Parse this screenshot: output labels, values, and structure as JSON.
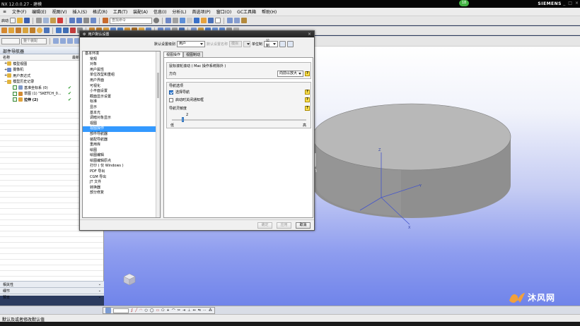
{
  "window": {
    "title": "NX 12.0.0.27 - 建模",
    "brand": "SIEMENS",
    "badge": "18"
  },
  "menubar": {
    "items": [
      "文件(F)",
      "编辑(E)",
      "视图(V)",
      "插入(S)",
      "格式(R)",
      "工具(T)",
      "装配(A)",
      "信息(I)",
      "分析(L)",
      "首选项(P)",
      "窗口(O)",
      "GC工具箱",
      "帮助(H)"
    ]
  },
  "toolbar": {
    "start_label": "启动",
    "search_placeholder": "查找命令",
    "filter_label": "整个装配"
  },
  "part_navigator": {
    "title": "部件导航器",
    "col_name": "名称",
    "col_latest": "最新",
    "rows": [
      {
        "label": "模型视图",
        "indent": 1,
        "type": "folder",
        "check": ""
      },
      {
        "label": "摄像机",
        "indent": 1,
        "type": "folder",
        "check": ""
      },
      {
        "label": "用户表达式",
        "indent": 1,
        "type": "folder",
        "check": ""
      },
      {
        "label": "模型历史记录",
        "indent": 1,
        "type": "folder",
        "check": ""
      },
      {
        "label": "基准坐标系 (0)",
        "indent": 2,
        "type": "feature",
        "check": "✔"
      },
      {
        "label": "草图 (1) \"SKETCH_0...",
        "indent": 2,
        "type": "feature",
        "check": "✔"
      },
      {
        "label": "拉伸 (2)",
        "indent": 2,
        "type": "feature",
        "check": "✔"
      }
    ],
    "bottom_panels": [
      "相关性",
      "细节",
      "预览"
    ]
  },
  "dialog": {
    "title": "用户默认设置",
    "level_label": "默认设置级别",
    "level_value": "用户",
    "import_label": "默认设置名称",
    "import_value": "模拟",
    "unit_label": "单位制",
    "unit_value": "公制",
    "categories": [
      {
        "label": "基本环境",
        "first": true
      },
      {
        "label": "常规"
      },
      {
        "label": "对象"
      },
      {
        "label": "用户属性"
      },
      {
        "label": "单位改型和重组"
      },
      {
        "label": "用户界面"
      },
      {
        "label": "可视化"
      },
      {
        "label": "小平面设置"
      },
      {
        "label": "截面显示设置"
      },
      {
        "label": "标准"
      },
      {
        "label": "显示"
      },
      {
        "label": "基本光"
      },
      {
        "label": "调暗对象显示"
      },
      {
        "label": "视图"
      },
      {
        "label": "视图操作",
        "selected": true
      },
      {
        "label": "部件导航器"
      },
      {
        "label": "装配导航器"
      },
      {
        "label": "重用库"
      },
      {
        "label": "绘图"
      },
      {
        "label": "绘图编辑"
      },
      {
        "label": "绘图编辑原点"
      },
      {
        "label": "打印 ( 仅 Windows )"
      },
      {
        "label": "PDF 导出"
      },
      {
        "label": "CGM 导出"
      },
      {
        "label": "JT 文件"
      },
      {
        "label": "转换器"
      },
      {
        "label": "部分修复"
      }
    ],
    "tabs": [
      "视图操作",
      "视图制动"
    ],
    "group1": {
      "title": "鼠标滚轮滚动 ( Mac 操作系统除外 )",
      "direction_label": "方向",
      "direction_value": "向前以放大"
    },
    "group2": {
      "title": "导航选项",
      "option1": "选择导航",
      "option1_checked": true,
      "option2": "启动时关闭通知框",
      "option2_checked": false,
      "sensitivity_label": "导航灵敏度",
      "sensitivity_value": "2",
      "low_label": "低",
      "high_label": "高"
    },
    "buttons": {
      "ok": "确定",
      "apply": "应用",
      "cancel": "取消"
    }
  },
  "statusbar": {
    "text": "默认及或者修改默认值"
  },
  "watermark": {
    "name": "沐风网",
    "url": "www.mfcad.com"
  },
  "colors": {
    "accent": "#3399ff",
    "title_bg": "#050505",
    "viewport_top": "#ffffff",
    "viewport_bottom": "#7084ea",
    "cylinder": "#8f8f8f"
  }
}
